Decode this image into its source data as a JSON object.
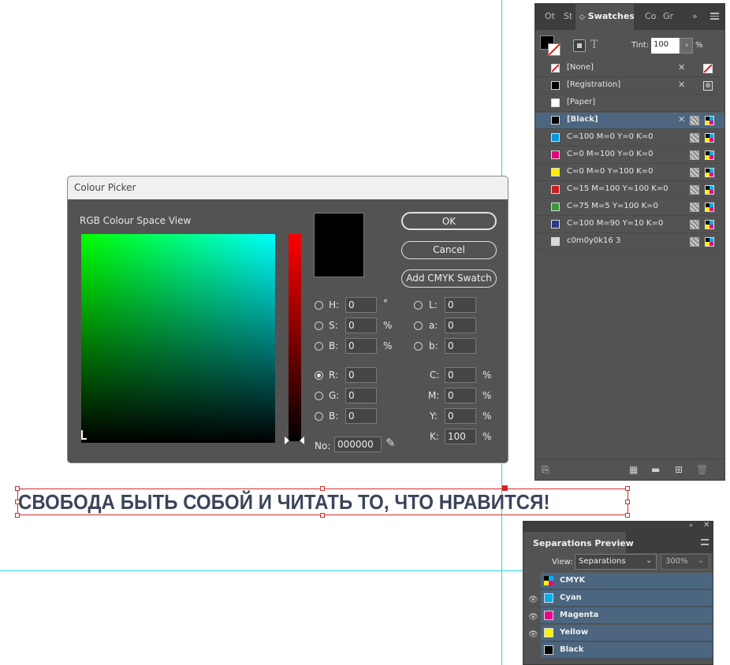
{
  "swatches_panel": {
    "tabs": [
      "Ot",
      "St",
      "Swatches",
      "Co",
      "Gr"
    ],
    "tint_label": "Tint:",
    "tint_value": "100",
    "tint_unit": "%",
    "items": [
      {
        "name": "[None]",
        "color": "none"
      },
      {
        "name": "[Registration]",
        "color": "#000000"
      },
      {
        "name": "[Paper]",
        "color": "#ffffff"
      },
      {
        "name": "[Black]",
        "color": "#000000",
        "selected": true
      },
      {
        "name": "C=100 M=0 Y=0 K=0",
        "color": "#0099dd"
      },
      {
        "name": "C=0 M=100 Y=0 K=0",
        "color": "#e0007a"
      },
      {
        "name": "C=0 M=0 Y=100 K=0",
        "color": "#ffee00"
      },
      {
        "name": "C=15 M=100 Y=100 K=0",
        "color": "#cc1f1f"
      },
      {
        "name": "C=75 M=5 Y=100 K=0",
        "color": "#3a9a35"
      },
      {
        "name": "C=100 M=90 Y=10 K=0",
        "color": "#2b3a87"
      },
      {
        "name": "c0m0y0k16 3",
        "color": "#d6d6d6"
      }
    ]
  },
  "colour_picker": {
    "title": "Colour Picker",
    "space_label": "RGB Colour Space View",
    "ok_label": "OK",
    "cancel_label": "Cancel",
    "add_swatch_label": "Add CMYK Swatch",
    "hsb": [
      {
        "label": "H:",
        "value": "0",
        "unit": "°"
      },
      {
        "label": "S:",
        "value": "0",
        "unit": "%"
      },
      {
        "label": "B:",
        "value": "0",
        "unit": "%"
      }
    ],
    "lab": [
      {
        "label": "L:",
        "value": "0"
      },
      {
        "label": "a:",
        "value": "0"
      },
      {
        "label": "b:",
        "value": "0"
      }
    ],
    "rgb": [
      {
        "label": "R:",
        "value": "0",
        "selected": true
      },
      {
        "label": "G:",
        "value": "0"
      },
      {
        "label": "B:",
        "value": "0"
      }
    ],
    "cmyk": [
      {
        "label": "C:",
        "value": "0",
        "unit": "%"
      },
      {
        "label": "M:",
        "value": "0",
        "unit": "%"
      },
      {
        "label": "Y:",
        "value": "0",
        "unit": "%"
      },
      {
        "label": "K:",
        "value": "100",
        "unit": "%"
      }
    ],
    "hex_label": "No:",
    "hex_value": "000000",
    "current_color": "#000000"
  },
  "headline": {
    "text": "СВОБОДА БЫТЬ СОБОЙ И ЧИТАТЬ ТО, ЧТО НРАВИТСЯ!"
  },
  "separations_panel": {
    "title": "Separations Preview",
    "view_label": "View:",
    "view_value": "Separations",
    "zoom_value": "300%",
    "items": [
      {
        "name": "CMYK",
        "color": "cmyk",
        "visible": false
      },
      {
        "name": "Cyan",
        "color": "#00aeef",
        "visible": true
      },
      {
        "name": "Magenta",
        "color": "#ec008c",
        "visible": true
      },
      {
        "name": "Yellow",
        "color": "#fff200",
        "visible": true
      },
      {
        "name": "Black",
        "color": "#000000",
        "visible": false
      }
    ]
  }
}
